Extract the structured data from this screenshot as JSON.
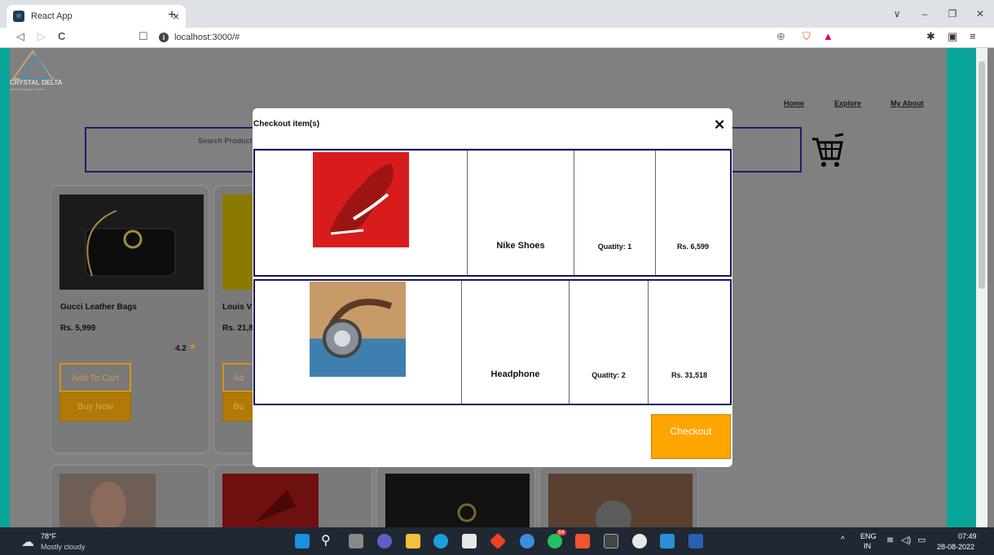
{
  "browser": {
    "tab_title": "React App",
    "tab_close": "×",
    "new_tab": "+",
    "url": "localhost:3000/#",
    "window_controls": [
      "∨",
      "–",
      "❐",
      "✕"
    ],
    "nav": {
      "back": "◁",
      "forward": "▷",
      "reload": "C",
      "bookmark": "☐"
    }
  },
  "site": {
    "logo_text": "CRYSTAL DELTA",
    "logo_sub": "SOLUTIONS DESIGN STUDIO",
    "nav": [
      "Home",
      "Explore",
      "My About"
    ],
    "search_placeholder": "Search Product"
  },
  "products": [
    {
      "name": "Gucci Leather Bags",
      "price": "Rs. 5,999",
      "rating": "4.2",
      "add_label": "Add To Cart",
      "buy_label": "Buy Now"
    },
    {
      "name": "Louis V",
      "price": "Rs. 21,8",
      "add_label": "Ad",
      "buy_label": "Bu"
    }
  ],
  "modal": {
    "title": "Checkout item(s)",
    "close": "✕",
    "items": [
      {
        "name": "Nike Shoes",
        "quantity": "Quatity: 1",
        "price": "Rs. 6,599"
      },
      {
        "name": "Headphone",
        "quantity": "Quatity: 2",
        "price": "Rs. 31,518"
      }
    ],
    "checkout_label": "Checkout"
  },
  "taskbar": {
    "weather_temp": "78°F",
    "weather_desc": "Mostly cloudy",
    "lang_top": "ENG",
    "lang_bottom": "IN",
    "time": "07:49",
    "date": "28-08-2022",
    "badge": "64"
  },
  "colors": {
    "teal": "#0aa59a",
    "orange": "#ffa500",
    "navy": "#151563",
    "overlay": "#808080"
  }
}
